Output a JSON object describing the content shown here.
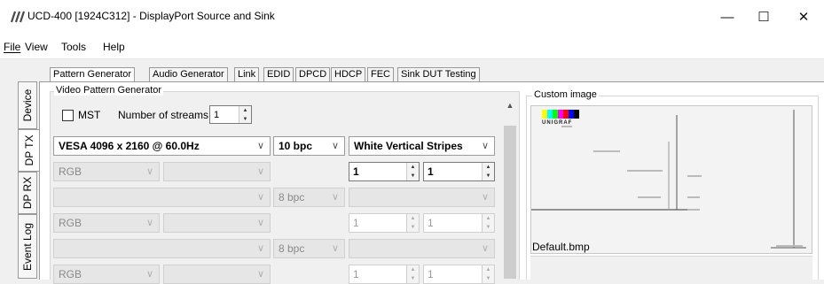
{
  "window": {
    "title": "UCD-400 [1924C312] - DisplayPort Source and Sink",
    "minimize": "—",
    "maximize": "☐",
    "close": "✕"
  },
  "menu": [
    "File",
    "View",
    "Tools",
    "Help"
  ],
  "vertical_tabs": [
    "Device",
    "DP TX",
    "DP RX",
    "Event Log"
  ],
  "tabs": [
    "Pattern Generator",
    "Audio Generator",
    "Link",
    "EDID",
    "DPCD",
    "HDCP",
    "FEC",
    "Sink DUT Testing"
  ],
  "video_group": {
    "label": "Video Pattern Generator",
    "mst_label": "MST",
    "streams_label": "Number of streams",
    "streams_value": "1"
  },
  "rows": [
    {
      "timing": "VESA 4096 x 2160 @ 60.0Hz",
      "bpc": "10 bpc",
      "pattern": "White Vertical Stripes"
    },
    {
      "color": "RGB",
      "sub": "",
      "val1": "1",
      "val2": "1"
    },
    {
      "timing": "",
      "bpc": "8 bpc",
      "pattern": ""
    },
    {
      "color": "RGB",
      "sub": "",
      "val1": "1",
      "val2": "1"
    },
    {
      "timing": "",
      "bpc": "8 bpc",
      "pattern": ""
    },
    {
      "color": "RGB",
      "sub": "",
      "val1": "1",
      "val2": "1"
    }
  ],
  "custom_image": {
    "label": "Custom image",
    "logo_text": "UNIGRAF",
    "filename": "Default.bmp"
  }
}
